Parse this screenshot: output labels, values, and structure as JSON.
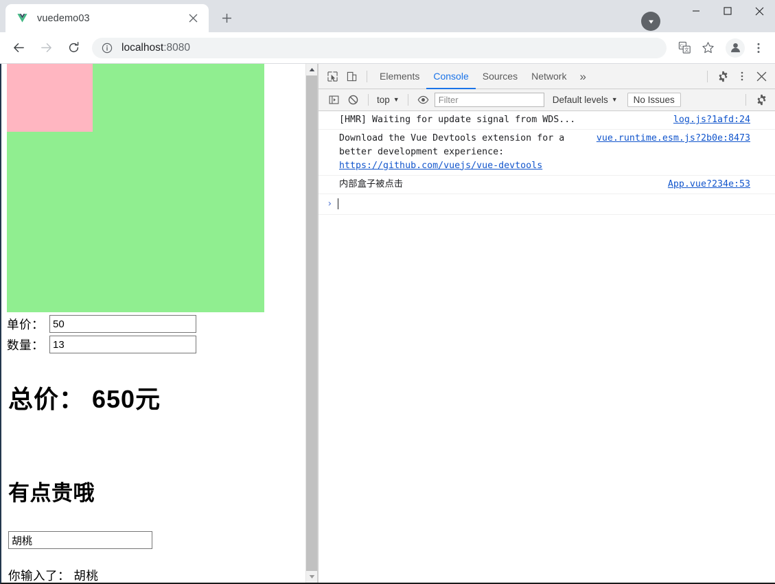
{
  "window": {
    "minimize_label": "Minimize",
    "maximize_label": "Maximize",
    "close_label": "Close",
    "download_badge_label": "Downloads"
  },
  "tabstrip": {
    "tab_title": "vuedemo03",
    "tab_close_label": "×",
    "new_tab_label": "+"
  },
  "toolbar": {
    "back_label": "Back",
    "forward_label": "Forward",
    "reload_label": "Reload",
    "site_info_label": "View site information",
    "url_host": "localhost",
    "url_port": ":8080",
    "translate_label": "Translate this page",
    "bookmark_label": "Bookmark this tab",
    "profile_label": "Profile",
    "menu_label": "Customize and control Google Chrome"
  },
  "page": {
    "outer_box_color": "#90ee90",
    "inner_box_color": "#ffb6c1",
    "unit_price_label": "单价：",
    "unit_price_value": "50",
    "quantity_label": "数量：",
    "quantity_value": "13",
    "total_text": "总价： 650元",
    "price_comment": "有点贵哦",
    "text_input_value": "胡桃",
    "echo_text": "你输入了： 胡桃"
  },
  "devtools": {
    "inspect_label": "Inspect element",
    "device_toolbar_label": "Toggle device toolbar",
    "tabs": [
      {
        "label": "Elements",
        "active": false
      },
      {
        "label": "Console",
        "active": true
      },
      {
        "label": "Sources",
        "active": false
      },
      {
        "label": "Network",
        "active": false
      }
    ],
    "more_tabs_label": "»",
    "settings_label": "Settings",
    "more_options_label": "More options",
    "close_label": "Close DevTools",
    "filterbar": {
      "sidebar_toggle_label": "Show console sidebar",
      "clear_console_label": "Clear console",
      "context_value": "top",
      "live_expression_label": "Create live expression",
      "filter_placeholder": "Filter",
      "filter_value": "",
      "levels_value": "Default levels",
      "issues_value": "No Issues",
      "console_settings_label": "Console settings"
    },
    "console_messages": [
      {
        "text": "[HMR] Waiting for update signal from WDS...",
        "link": "log.js?1afd:24",
        "has_inline_link": false,
        "inline_link_text": ""
      },
      {
        "text": "Download the Vue Devtools extension for a better development experience:\n",
        "link": "vue.runtime.esm.js?2b0e:8473",
        "has_inline_link": true,
        "inline_link_text": "https://github.com/vuejs/vue-devtools"
      },
      {
        "text": "内部盒子被点击",
        "link": "App.vue?234e:53",
        "has_inline_link": false,
        "inline_link_text": ""
      }
    ],
    "prompt_caret": "›"
  }
}
